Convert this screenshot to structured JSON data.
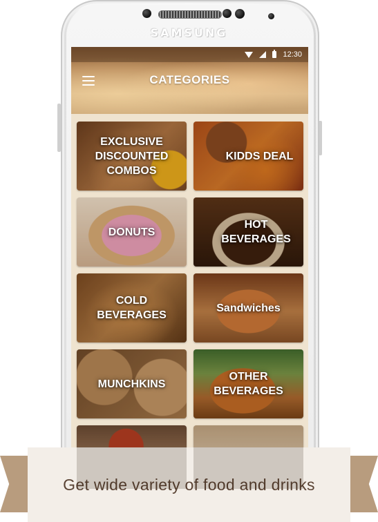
{
  "device": {
    "brand": "SAMSUNG"
  },
  "status_bar": {
    "time": "12:30",
    "icons": [
      "wifi-icon",
      "signal-icon",
      "battery-icon"
    ]
  },
  "header": {
    "title": "CATEGORIES",
    "menu_icon": "hamburger-menu-icon"
  },
  "categories": [
    {
      "label": "EXCLUSIVE DISCOUNTED COMBOS"
    },
    {
      "label": "KIDDS DEAL"
    },
    {
      "label": "DONUTS"
    },
    {
      "label": "HOT BEVERAGES"
    },
    {
      "label": "COLD BEVERAGES"
    },
    {
      "label": "Sandwiches"
    },
    {
      "label": "MUNCHKINS"
    },
    {
      "label": "OTHER BEVERAGES"
    },
    {
      "label": ""
    },
    {
      "label": ""
    }
  ],
  "caption": {
    "text": "Get wide variety of food and drinks"
  },
  "colors": {
    "ribbon": "#b89c7e",
    "caption_bg": "#f3eee8",
    "caption_text": "#5a4334"
  }
}
